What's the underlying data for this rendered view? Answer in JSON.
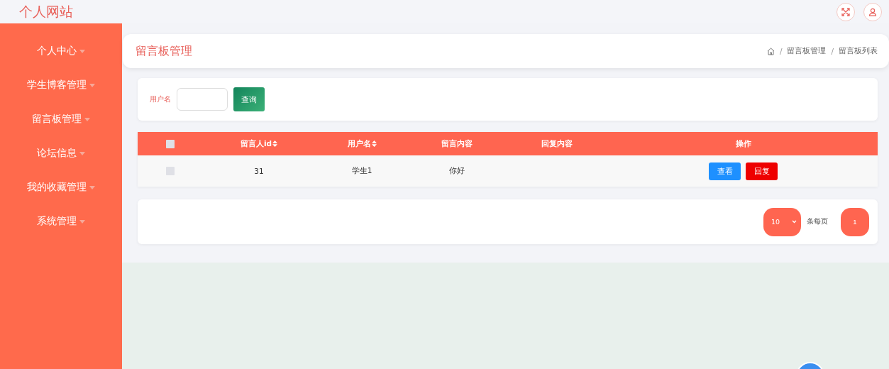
{
  "header": {
    "site_title": "个人网站"
  },
  "sidebar": {
    "items": [
      {
        "label": "个人中心"
      },
      {
        "label": "学生博客管理"
      },
      {
        "label": "留言板管理"
      },
      {
        "label": "论坛信息"
      },
      {
        "label": "我的收藏管理"
      },
      {
        "label": "系统管理"
      }
    ]
  },
  "page_header": {
    "title": "留言板管理",
    "breadcrumb": [
      {
        "separator": "/",
        "label": "留言板管理"
      },
      {
        "separator": "/",
        "label": "留言板列表"
      }
    ]
  },
  "search": {
    "label": "用户名",
    "button": "查询"
  },
  "table": {
    "header_checkbox": {
      "checked": false
    },
    "columns": [
      {
        "label": "留言人id",
        "sortable": true
      },
      {
        "label": "用户名",
        "sortable": true
      },
      {
        "label": "留言内容",
        "sortable": false
      },
      {
        "label": "回复内容",
        "sortable": false
      },
      {
        "label": "操作",
        "sortable": false
      }
    ],
    "rows": [
      {
        "checked": false,
        "cells": [
          "31",
          "学生1",
          "你好"
        ],
        "actions": [
          {
            "label": "查看",
            "kind": "view"
          },
          {
            "label": "回复",
            "kind": "reply"
          }
        ]
      }
    ]
  },
  "pagination": {
    "page_size": "10",
    "page_size_suffix": "条每页",
    "pages": [
      {
        "label": "1",
        "selected": true
      }
    ]
  }
}
